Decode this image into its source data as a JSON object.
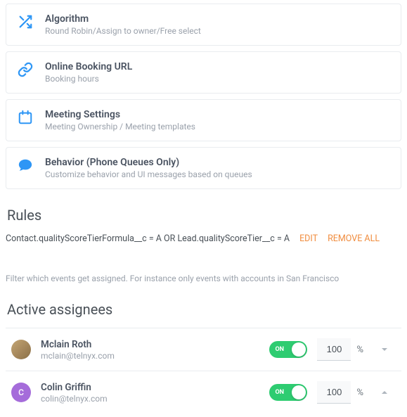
{
  "cards": [
    {
      "icon": "shuffle-icon",
      "title": "Algorithm",
      "sub": "Round Robin/Assign to owner/Free select"
    },
    {
      "icon": "link-icon",
      "title": "Online Booking URL",
      "sub": "Booking hours"
    },
    {
      "icon": "calendar-icon",
      "title": "Meeting Settings",
      "sub": "Meeting Ownership / Meeting templates"
    },
    {
      "icon": "comment-icon",
      "title": "Behavior (Phone Queues Only)",
      "sub": "Customize behavior and UI messages based on queues"
    }
  ],
  "rules": {
    "heading": "Rules",
    "expression": "Contact.qualityScoreTierFormula__c = A OR Lead.qualityScoreTier__c = A",
    "edit_label": "EDIT",
    "remove_label": "REMOVE ALL",
    "help": "Filter which events get assigned. For instance only events with accounts in San Francisco"
  },
  "assignees": {
    "heading": "Active assignees",
    "toggle_on_label": "ON",
    "percent_sign": "%",
    "items": [
      {
        "name": "Mclain Roth",
        "email": "mclain@telnyx.com",
        "percent": "100",
        "avatar_initial": "",
        "avatar_type": "img",
        "chevron": "down"
      },
      {
        "name": "Colin Griffin",
        "email": "colin@telnyx.com",
        "percent": "100",
        "avatar_initial": "C",
        "avatar_type": "letter",
        "chevron": "up"
      }
    ]
  }
}
